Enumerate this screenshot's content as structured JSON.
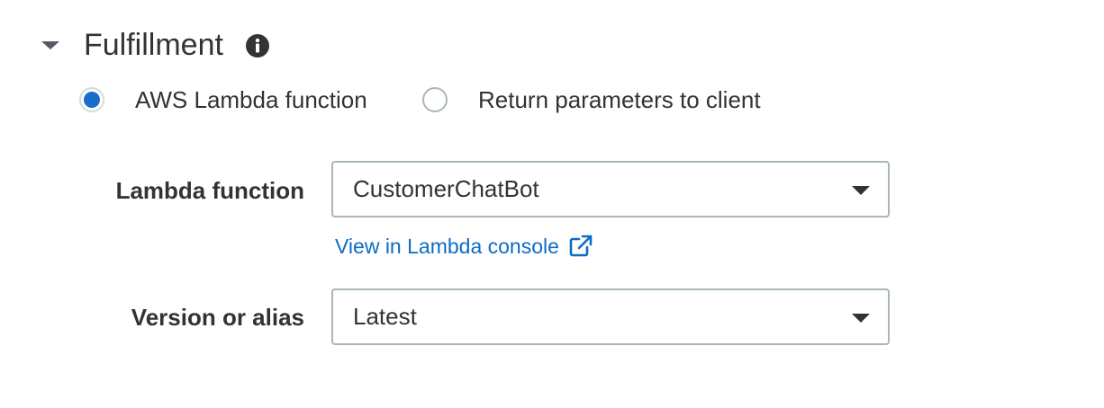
{
  "section": {
    "title": "Fulfillment",
    "collapse_icon": "caret-down-icon",
    "info_icon": "info-icon"
  },
  "fulfillment_type": {
    "options": [
      {
        "label": "AWS Lambda function",
        "selected": true
      },
      {
        "label": "Return parameters to client",
        "selected": false
      }
    ]
  },
  "lambda_function": {
    "label": "Lambda function",
    "value": "CustomerChatBot",
    "link_text": "View in Lambda console",
    "link_icon": "external-link-icon"
  },
  "version_alias": {
    "label": "Version or alias",
    "value": "Latest"
  },
  "colors": {
    "accent": "#1a6cc9",
    "link": "#0c6cc4",
    "text": "#333333",
    "border": "#aab7b8"
  }
}
